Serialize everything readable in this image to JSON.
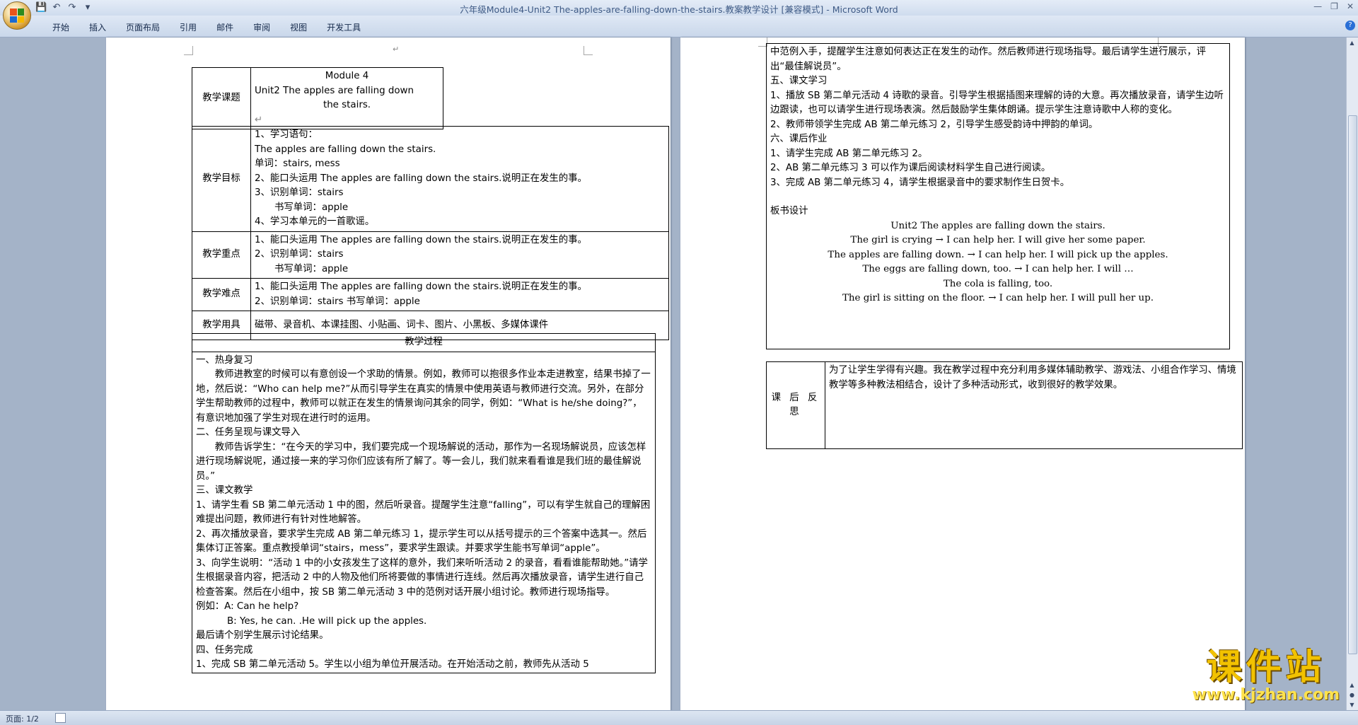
{
  "window": {
    "title": "六年级Module4-Unit2 The-apples-are-falling-down-the-stairs.教案教学设计 [兼容模式] - Microsoft Word"
  },
  "ribbon": {
    "tabs": [
      "开始",
      "插入",
      "页面布局",
      "引用",
      "邮件",
      "审阅",
      "视图",
      "开发工具"
    ]
  },
  "status": {
    "page": "页面: 1/2"
  },
  "watermark": {
    "line1": "课件站",
    "line2": "www.kjzhan.com"
  },
  "page1": {
    "topic_label": "教学课题",
    "topic": [
      "Module 4",
      "Unit2 The apples are falling down",
      "the stairs."
    ],
    "goals_label": "教学目标",
    "goals": [
      "1、学习语句：",
      "The apples are falling down the stairs.",
      "单词：stairs, mess",
      "2、能口头运用 The apples are falling down the stairs.说明正在发生的事。",
      "3、识别单词：stairs",
      "书写单词：apple",
      "4、学习本单元的一首歌谣。"
    ],
    "key_label": "教学重点",
    "key": [
      "1、能口头运用 The apples are falling down the stairs.说明正在发生的事。",
      "2、识别单词：stairs",
      "书写单词：apple"
    ],
    "diff_label": "教学难点",
    "diff": [
      "1、能口头运用 The apples are falling down the stairs.说明正在发生的事。",
      "2、识别单词：stairs    书写单词：apple"
    ],
    "tools_label": "教学用具",
    "tools": "磁带、录音机、本课挂图、小贴画、词卡、图片、小黑板、多媒体课件",
    "process_label": "教学过程",
    "process": [
      "一、热身复习",
      "教师进教室的时候可以有意创设一个求助的情景。例如，教师可以抱很多作业本走进教室，结果书掉了一地，然后说：“Who can help me?”从而引导学生在真实的情景中使用英语与教师进行交流。另外，在部分学生帮助教师的过程中，教师可以就正在发生的情景询问其余的同学，例如：“What is he/she doing?”，有意识地加强了学生对现在进行时的运用。",
      "二、任务呈现与课文导入",
      "教师告诉学生：“在今天的学习中，我们要完成一个现场解说的活动，那作为一名现场解说员，应该怎样进行现场解说呢，通过接一来的学习你们应该有所了解了。等一会儿，我们就来看看谁是我们班的最佳解说员。”",
      "三、课文教学",
      "1、请学生看 SB 第二单元活动 1 中的图，然后听录音。提醒学生注意“falling”，可以有学生就自己的理解困难提出问题，教师进行有针对性地解答。",
      "2、再次播放录音，要求学生完成 AB 第二单元练习 1，提示学生可以从括号提示的三个答案中选其一。然后集体订正答案。重点教授单词“stairs，mess”，要求学生跟读。并要求学生能书写单词“apple”。",
      "3、向学生说明：“活动 1 中的小女孩发生了这样的意外，我们来听听活动 2 的录音，看看谁能帮助她。”请学生根据录音内容，把活动 2 中的人物及他们所将要做的事情进行连线。然后再次播放录音，请学生进行自己检查答案。然后在小组中，按 SB 第二单元活动 3 中的范例对话开展小组讨论。教师进行现场指导。",
      "例如：A: Can he help?",
      "B: Yes, he can. .He will pick up the apples.",
      "最后请个别学生展示讨论结果。",
      "四、任务完成",
      "1、完成 SB 第二单元活动 5。学生以小组为单位开展活动。在开始活动之前，教师先从活动 5"
    ]
  },
  "page2": {
    "lines": [
      "中范例入手，提醒学生注意如何表达正在发生的动作。然后教师进行现场指导。最后请学生进行展示，评出“最佳解说员”。",
      "五、课文学习",
      "1、播放 SB 第二单元活动 4 诗歌的录音。引导学生根据插图来理解的诗的大意。再次播放录音，请学生边听边跟读，也可以请学生进行现场表演。然后鼓励学生集体朗诵。提示学生注意诗歌中人称的变化。",
      "2、教师带领学生完成 AB 第二单元练习 2，引导学生感受韵诗中押韵的单词。",
      "六、课后作业",
      "1、请学生完成 AB 第二单元练习 2。",
      "2、AB 第二单元练习 3 可以作为课后阅读材料学生自己进行阅读。",
      "3、完成 AB 第二单元练习 4，请学生根据录音中的要求制作生日贺卡。"
    ],
    "board_label": "板书设计",
    "board": [
      "Unit2 The apples are falling down the stairs.",
      "The girl is crying   →   I can help her. I will give her some paper.",
      "The apples are falling down. → I can help her. I will pick up the apples.",
      "The eggs are falling down, too. →   I can help her. I will …",
      "The cola is falling, too.",
      "The girl is sitting on the floor. → I can help her.   I will pull her up."
    ],
    "reflect_label": "课 后 反 思",
    "reflect": "为了让学生学得有兴趣。我在教学过程中充分利用多媒体辅助教学、游戏法、小组合作学习、情境教学等多种教法相结合，设计了多种活动形式，收到很好的教学效果。"
  }
}
